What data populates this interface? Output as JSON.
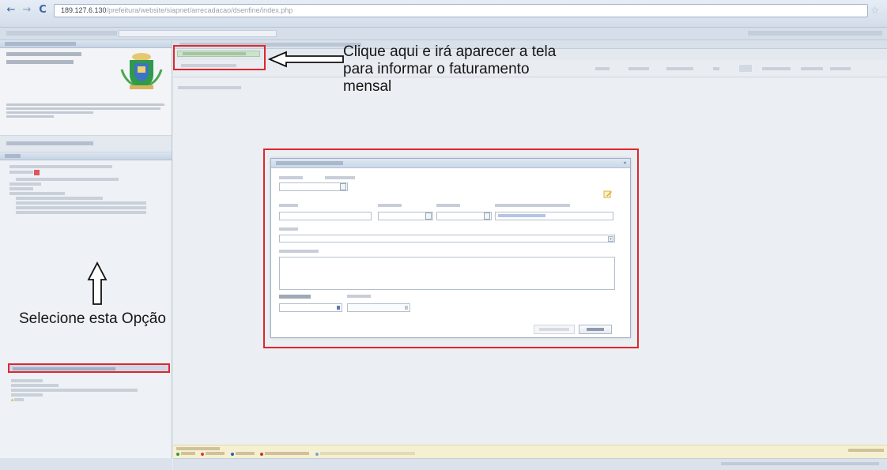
{
  "browser": {
    "url_host": "189.127.6.130",
    "url_path": "/prefeitura/website/siapnet/arrecadacao/dsenfine/index.php",
    "nav_back": "←",
    "nav_forward": "→",
    "nav_reload": "C",
    "star": "☆"
  },
  "annotations": {
    "top_lines": [
      "Clique aqui e irá aparecer a tela",
      "para informar o faturamento",
      "mensal"
    ],
    "bottom": "Selecione esta Opção"
  },
  "colors": {
    "highlight": "#e0262c",
    "legend_normal": "#3a9a3a",
    "legend_cancelado": "#d73a3a",
    "legend_retornado": "#2a5fb3",
    "legend_cancelado_retornado": "#c0392b",
    "legend_substituido": "#7aa6d6"
  },
  "icons": [
    "back-icon",
    "forward-icon",
    "reload-icon",
    "star-icon",
    "calendar-icon",
    "lookup-icon",
    "edit-icon",
    "dropdown-arrow-icon",
    "close-icon",
    "folder-icon",
    "crest-icon"
  ]
}
